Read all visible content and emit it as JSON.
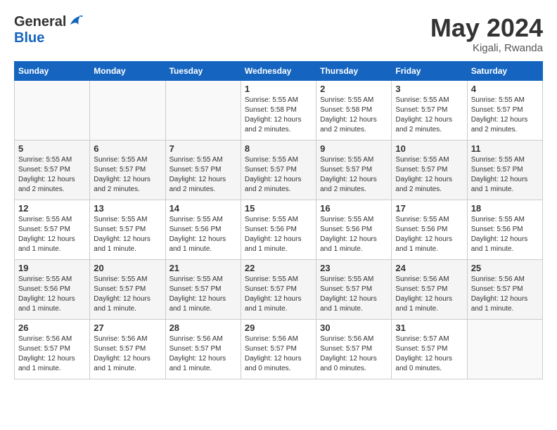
{
  "header": {
    "logo_general": "General",
    "logo_blue": "Blue",
    "month": "May 2024",
    "location": "Kigali, Rwanda"
  },
  "days_of_week": [
    "Sunday",
    "Monday",
    "Tuesday",
    "Wednesday",
    "Thursday",
    "Friday",
    "Saturday"
  ],
  "weeks": [
    [
      {
        "day": "",
        "info": ""
      },
      {
        "day": "",
        "info": ""
      },
      {
        "day": "",
        "info": ""
      },
      {
        "day": "1",
        "info": "Sunrise: 5:55 AM\nSunset: 5:58 PM\nDaylight: 12 hours\nand 2 minutes."
      },
      {
        "day": "2",
        "info": "Sunrise: 5:55 AM\nSunset: 5:58 PM\nDaylight: 12 hours\nand 2 minutes."
      },
      {
        "day": "3",
        "info": "Sunrise: 5:55 AM\nSunset: 5:57 PM\nDaylight: 12 hours\nand 2 minutes."
      },
      {
        "day": "4",
        "info": "Sunrise: 5:55 AM\nSunset: 5:57 PM\nDaylight: 12 hours\nand 2 minutes."
      }
    ],
    [
      {
        "day": "5",
        "info": "Sunrise: 5:55 AM\nSunset: 5:57 PM\nDaylight: 12 hours\nand 2 minutes."
      },
      {
        "day": "6",
        "info": "Sunrise: 5:55 AM\nSunset: 5:57 PM\nDaylight: 12 hours\nand 2 minutes."
      },
      {
        "day": "7",
        "info": "Sunrise: 5:55 AM\nSunset: 5:57 PM\nDaylight: 12 hours\nand 2 minutes."
      },
      {
        "day": "8",
        "info": "Sunrise: 5:55 AM\nSunset: 5:57 PM\nDaylight: 12 hours\nand 2 minutes."
      },
      {
        "day": "9",
        "info": "Sunrise: 5:55 AM\nSunset: 5:57 PM\nDaylight: 12 hours\nand 2 minutes."
      },
      {
        "day": "10",
        "info": "Sunrise: 5:55 AM\nSunset: 5:57 PM\nDaylight: 12 hours\nand 2 minutes."
      },
      {
        "day": "11",
        "info": "Sunrise: 5:55 AM\nSunset: 5:57 PM\nDaylight: 12 hours\nand 1 minute."
      }
    ],
    [
      {
        "day": "12",
        "info": "Sunrise: 5:55 AM\nSunset: 5:57 PM\nDaylight: 12 hours\nand 1 minute."
      },
      {
        "day": "13",
        "info": "Sunrise: 5:55 AM\nSunset: 5:57 PM\nDaylight: 12 hours\nand 1 minute."
      },
      {
        "day": "14",
        "info": "Sunrise: 5:55 AM\nSunset: 5:56 PM\nDaylight: 12 hours\nand 1 minute."
      },
      {
        "day": "15",
        "info": "Sunrise: 5:55 AM\nSunset: 5:56 PM\nDaylight: 12 hours\nand 1 minute."
      },
      {
        "day": "16",
        "info": "Sunrise: 5:55 AM\nSunset: 5:56 PM\nDaylight: 12 hours\nand 1 minute."
      },
      {
        "day": "17",
        "info": "Sunrise: 5:55 AM\nSunset: 5:56 PM\nDaylight: 12 hours\nand 1 minute."
      },
      {
        "day": "18",
        "info": "Sunrise: 5:55 AM\nSunset: 5:56 PM\nDaylight: 12 hours\nand 1 minute."
      }
    ],
    [
      {
        "day": "19",
        "info": "Sunrise: 5:55 AM\nSunset: 5:56 PM\nDaylight: 12 hours\nand 1 minute."
      },
      {
        "day": "20",
        "info": "Sunrise: 5:55 AM\nSunset: 5:57 PM\nDaylight: 12 hours\nand 1 minute."
      },
      {
        "day": "21",
        "info": "Sunrise: 5:55 AM\nSunset: 5:57 PM\nDaylight: 12 hours\nand 1 minute."
      },
      {
        "day": "22",
        "info": "Sunrise: 5:55 AM\nSunset: 5:57 PM\nDaylight: 12 hours\nand 1 minute."
      },
      {
        "day": "23",
        "info": "Sunrise: 5:55 AM\nSunset: 5:57 PM\nDaylight: 12 hours\nand 1 minute."
      },
      {
        "day": "24",
        "info": "Sunrise: 5:56 AM\nSunset: 5:57 PM\nDaylight: 12 hours\nand 1 minute."
      },
      {
        "day": "25",
        "info": "Sunrise: 5:56 AM\nSunset: 5:57 PM\nDaylight: 12 hours\nand 1 minute."
      }
    ],
    [
      {
        "day": "26",
        "info": "Sunrise: 5:56 AM\nSunset: 5:57 PM\nDaylight: 12 hours\nand 1 minute."
      },
      {
        "day": "27",
        "info": "Sunrise: 5:56 AM\nSunset: 5:57 PM\nDaylight: 12 hours\nand 1 minute."
      },
      {
        "day": "28",
        "info": "Sunrise: 5:56 AM\nSunset: 5:57 PM\nDaylight: 12 hours\nand 1 minute."
      },
      {
        "day": "29",
        "info": "Sunrise: 5:56 AM\nSunset: 5:57 PM\nDaylight: 12 hours\nand 0 minutes."
      },
      {
        "day": "30",
        "info": "Sunrise: 5:56 AM\nSunset: 5:57 PM\nDaylight: 12 hours\nand 0 minutes."
      },
      {
        "day": "31",
        "info": "Sunrise: 5:57 AM\nSunset: 5:57 PM\nDaylight: 12 hours\nand 0 minutes."
      },
      {
        "day": "",
        "info": ""
      }
    ]
  ]
}
